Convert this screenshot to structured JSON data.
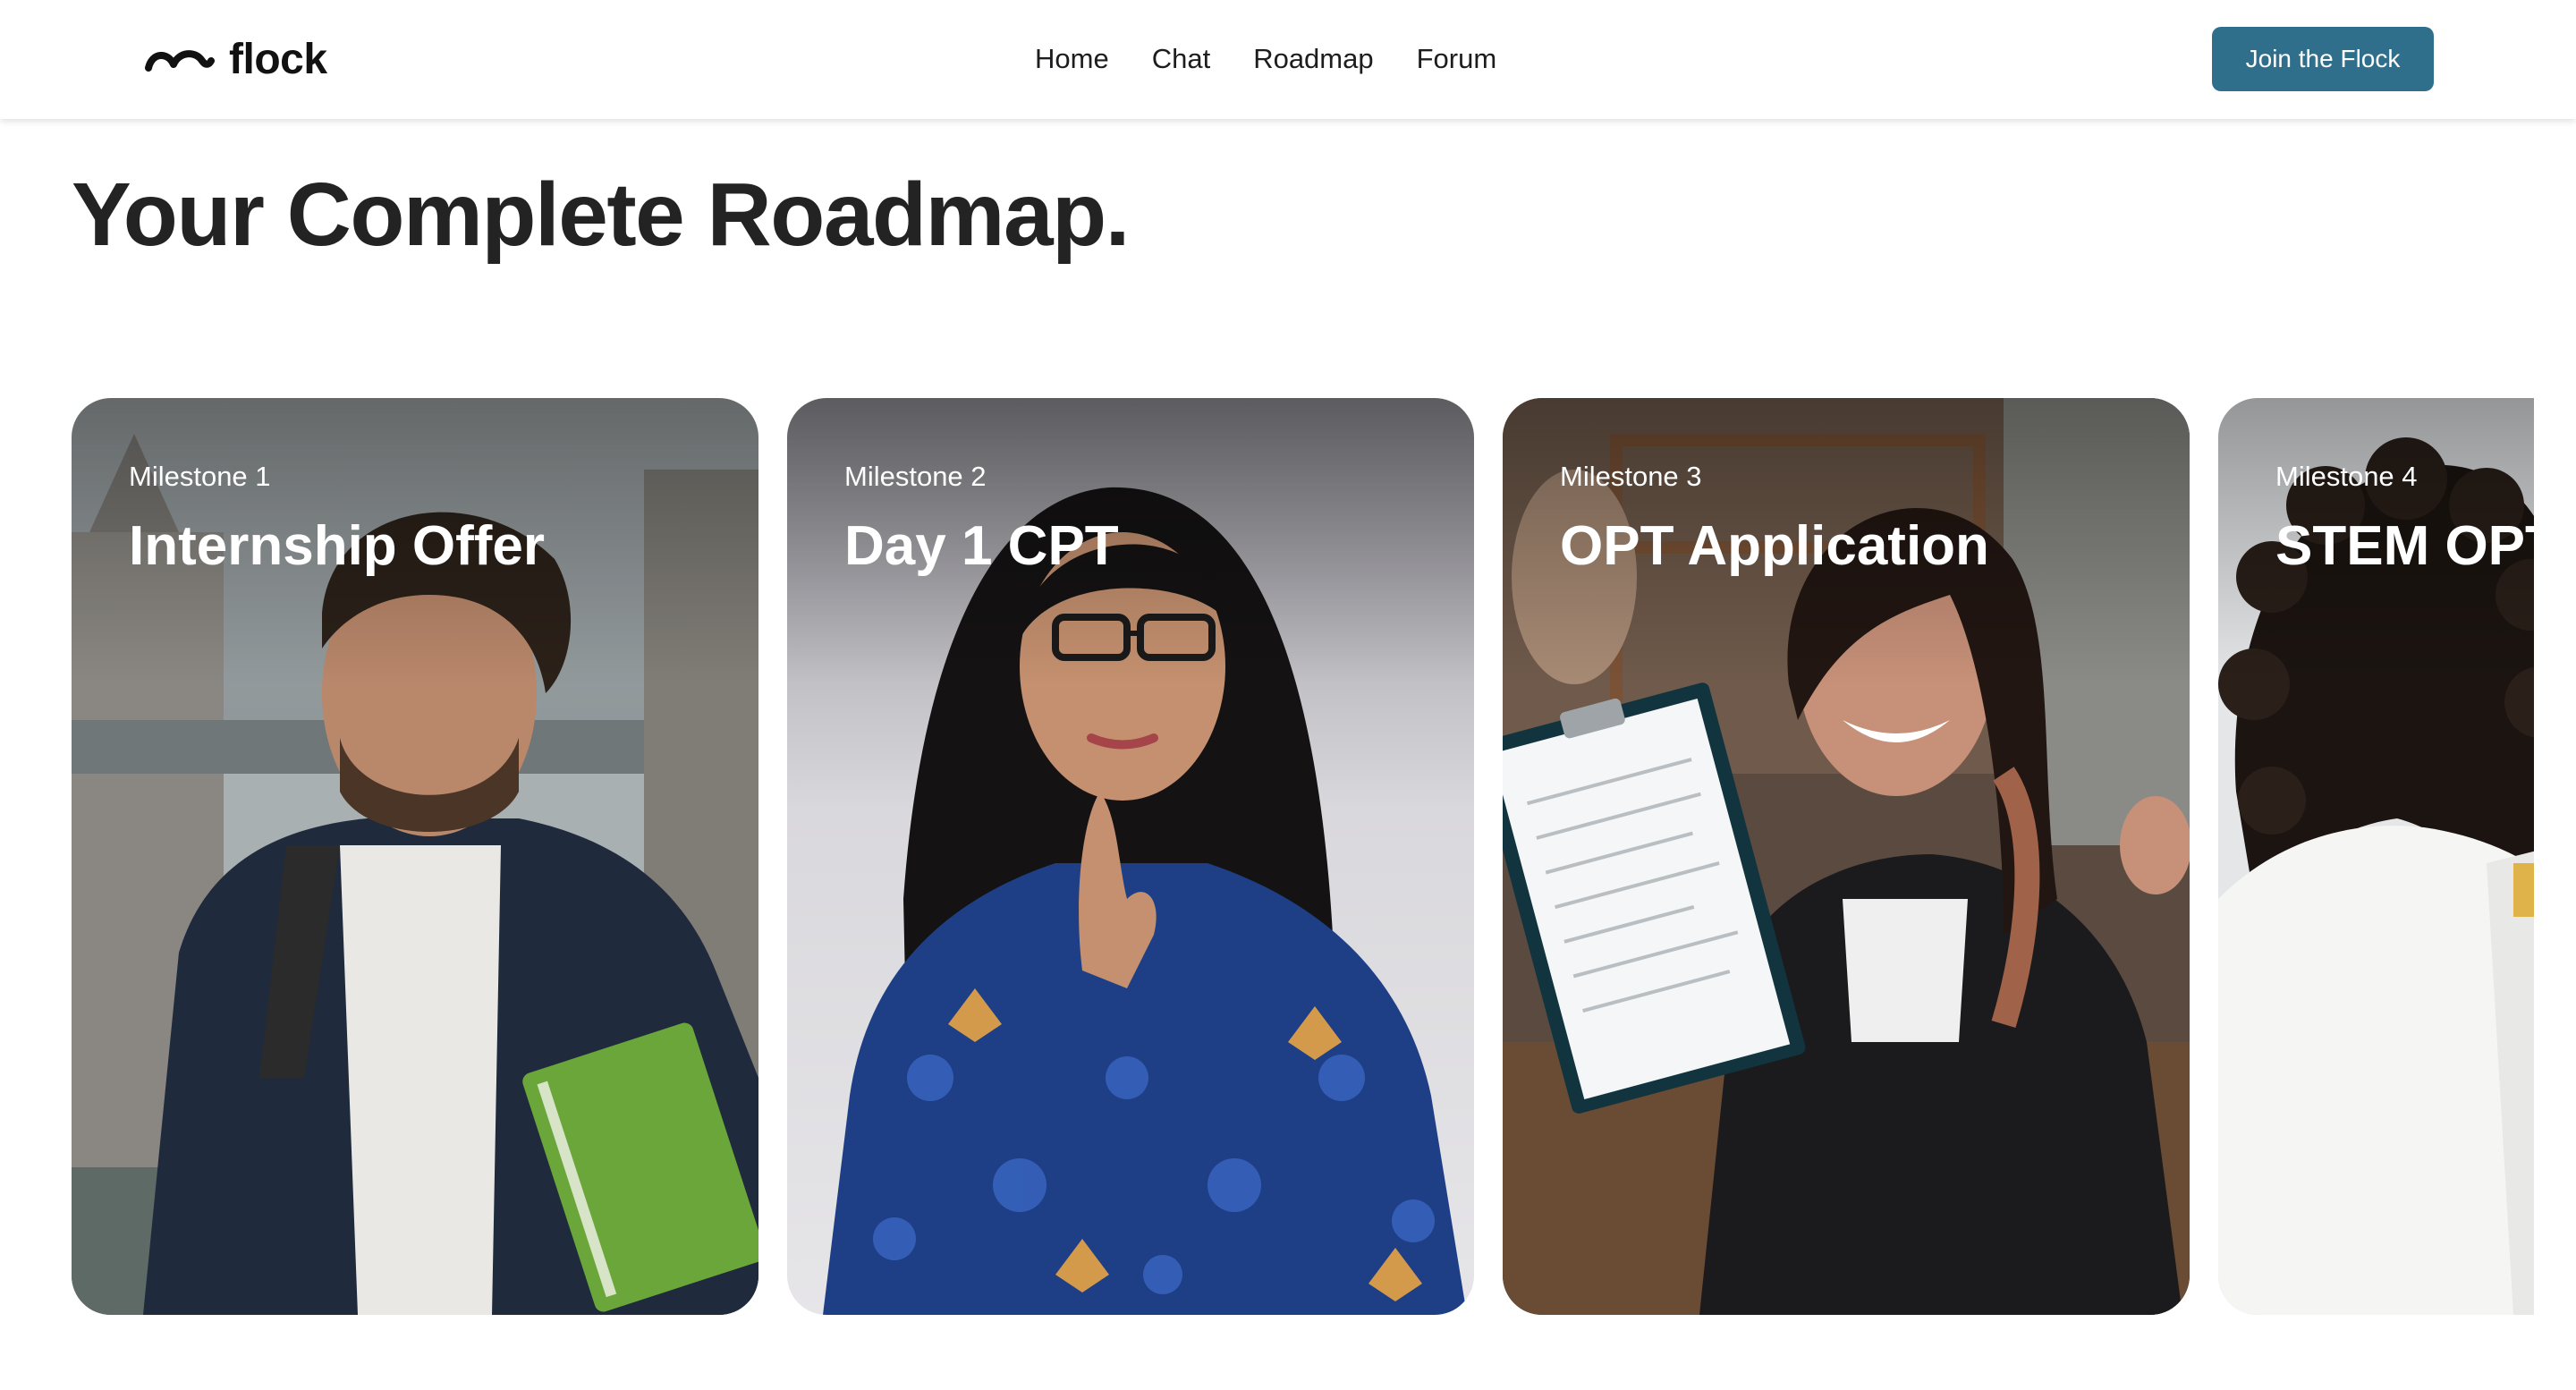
{
  "brand": {
    "name": "flock",
    "logo_icon": "flock-wave-logo"
  },
  "nav": {
    "links": [
      "Home",
      "Chat",
      "Roadmap",
      "Forum"
    ],
    "cta_label": "Join the Flock",
    "cta_color": "#2f6f8c"
  },
  "main": {
    "title": "Your Complete Roadmap."
  },
  "milestones": [
    {
      "label": "Milestone 1",
      "title": "Internship Offer"
    },
    {
      "label": "Milestone 2",
      "title": "Day 1 CPT"
    },
    {
      "label": "Milestone 3",
      "title": "OPT Application"
    },
    {
      "label": "Milestone 4",
      "title": "STEM OPT"
    }
  ]
}
